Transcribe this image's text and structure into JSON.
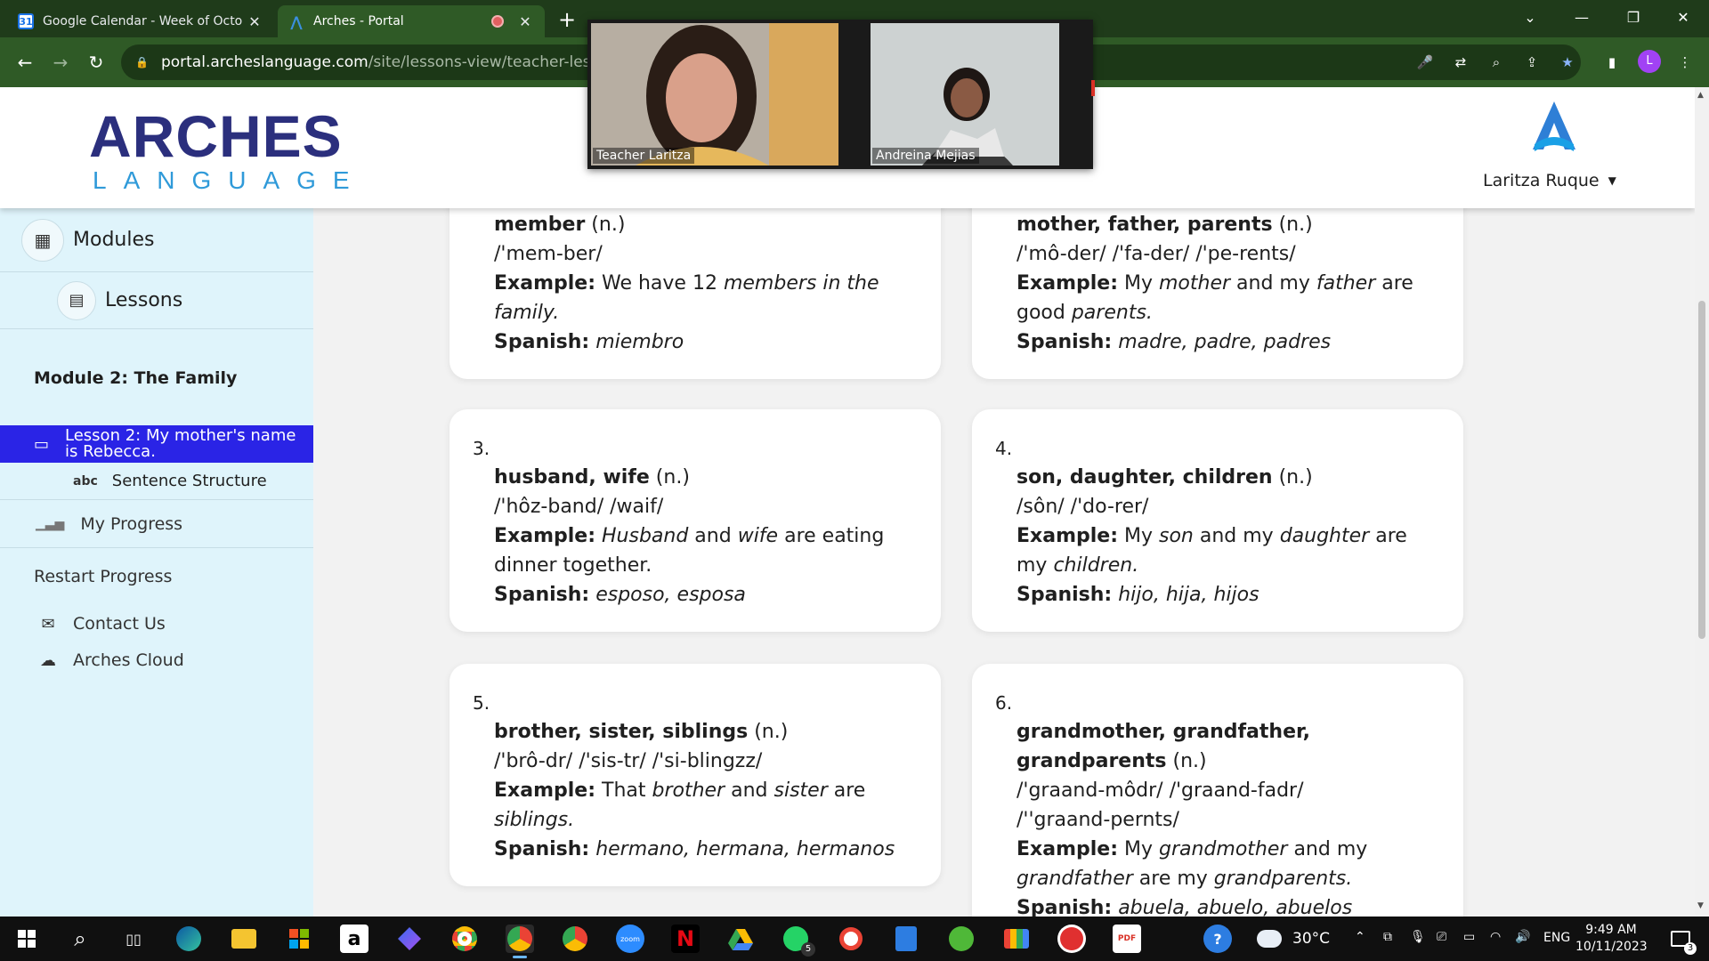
{
  "browser": {
    "tabs": [
      {
        "title": "Google Calendar - Week of Octo",
        "icon": "google-calendar-icon",
        "favicon_text": "31",
        "close": "✕"
      },
      {
        "title": "Arches - Portal",
        "icon": "arches-icon",
        "favicon_text": "⋀",
        "close": "✕"
      }
    ],
    "new_tab": "+",
    "window_controls": {
      "tab_search": "⌄",
      "minimize": "—",
      "restore": "❐",
      "close": "✕"
    },
    "nav": {
      "back": "←",
      "forward": "→",
      "reload": "↻"
    },
    "url_host": "portal.archeslanguage.com",
    "url_path": "/site/lessons-view/teacher-lesson/g",
    "profile_initial": "L",
    "toolbar_icons": {
      "mic": "🎤",
      "translate": "⇄",
      "zoom": "⌕",
      "share": "⇪",
      "bookmark": "★",
      "sidepanel": "▮",
      "menu": "⋮"
    }
  },
  "video": {
    "participants": [
      {
        "name": "Teacher Laritza"
      },
      {
        "name": "Andreina Mejias"
      }
    ]
  },
  "header": {
    "logo_top": "ARCHES",
    "logo_bottom": "LANGUAGE",
    "user_name": "Laritza Ruque",
    "caret": "▼"
  },
  "sidebar": {
    "modules_label": "Modules",
    "lessons_label": "Lessons",
    "module_title": "Module 2: The Family",
    "active_lesson": "Lesson 2: My mother's name is Rebecca.",
    "sentence_structure": "Sentence Structure",
    "sentence_icon": "abc",
    "my_progress": "My Progress",
    "restart_progress": "Restart Progress",
    "contact_us": "Contact Us",
    "arches_cloud": "Arches Cloud"
  },
  "labels": {
    "example": "Example:",
    "spanish": "Spanish:"
  },
  "cards": [
    {
      "number": "",
      "term": "member",
      "pos": "(n.)",
      "ipa": "/'mem-ber/",
      "example": [
        {
          "t": "We have 12 ",
          "i": false
        },
        {
          "t": "members in the family.",
          "i": true
        }
      ],
      "spanish": "miembro"
    },
    {
      "number": "",
      "term": "mother, father, parents",
      "pos": "(n.)",
      "ipa": "/'mô-der/ /'fa-der/ /'pe-rents/",
      "example": [
        {
          "t": "My ",
          "i": false
        },
        {
          "t": "mother",
          "i": true
        },
        {
          "t": " and my ",
          "i": false
        },
        {
          "t": "father",
          "i": true
        },
        {
          "t": " are good ",
          "i": false
        },
        {
          "t": "parents.",
          "i": true
        }
      ],
      "spanish": "madre, padre, padres"
    },
    {
      "number": "3.",
      "term": "husband, wife",
      "pos": "(n.)",
      "ipa": "/'hôz-band/ /waif/",
      "example": [
        {
          "t": "Husband",
          "i": true
        },
        {
          "t": " and ",
          "i": false
        },
        {
          "t": "wife",
          "i": true
        },
        {
          "t": " are eating dinner together.",
          "i": false
        }
      ],
      "spanish": "esposo, esposa"
    },
    {
      "number": "4.",
      "term": "son, daughter, children",
      "pos": "(n.)",
      "ipa": "/sôn/ /'do-rer/",
      "example": [
        {
          "t": "My ",
          "i": false
        },
        {
          "t": "son",
          "i": true
        },
        {
          "t": " and my ",
          "i": false
        },
        {
          "t": "daughter",
          "i": true
        },
        {
          "t": " are my ",
          "i": false
        },
        {
          "t": "children.",
          "i": true
        }
      ],
      "spanish": "hijo, hija, hijos"
    },
    {
      "number": "5.",
      "term": "brother, sister, siblings",
      "pos": "(n.)",
      "ipa": "/'brô-dr/ /'sis-tr/ /'si-blingzz/",
      "example": [
        {
          "t": "That ",
          "i": false
        },
        {
          "t": "brother",
          "i": true
        },
        {
          "t": " and ",
          "i": false
        },
        {
          "t": "sister",
          "i": true
        },
        {
          "t": " are ",
          "i": false
        },
        {
          "t": "siblings.",
          "i": true
        }
      ],
      "spanish": "hermano, hermana, hermanos"
    },
    {
      "number": "6.",
      "term": "grandmother, grandfather, grandparents",
      "pos": "(n.)",
      "ipa": "/'graand-môdr/ /'graand-fadr/ /''graand-pernts/",
      "example": [
        {
          "t": "My ",
          "i": false
        },
        {
          "t": "grandmother",
          "i": true
        },
        {
          "t": " and my ",
          "i": false
        },
        {
          "t": "grandfather",
          "i": true
        },
        {
          "t": " are my ",
          "i": false
        },
        {
          "t": "grandparents.",
          "i": true
        }
      ],
      "spanish": "abuela, abuelo, abuelos"
    }
  ],
  "taskbar": {
    "apps": [
      "windows-start-icon",
      "search-icon",
      "task-view-icon",
      "edge-icon",
      "file-explorer-icon",
      "store-icon",
      "amazon-icon",
      "copilot-icon",
      "chrome-icon",
      "chrome-profile-icon",
      "chrome-icon",
      "zoom-icon",
      "netflix-icon",
      "google-drive-icon",
      "whatsapp-icon",
      "brave-icon",
      "calculator-icon",
      "utorrent-icon",
      "meet-icon",
      "record-icon",
      "pdf-icon"
    ],
    "amazon_glyph": "a",
    "zoom_glyph": "zoom",
    "netflix_glyph": "N",
    "whatsapp_badge": "5",
    "pdf_glyph": "PDF",
    "help_glyph": "?",
    "temperature": "30°C",
    "language": "ENG",
    "time": "9:49 AM",
    "date": "10/11/2023",
    "notifications": "3"
  },
  "colors": {
    "tab_strip": "#1f3b1a",
    "toolbar": "#2f5a26",
    "sidebar_bg": "#dff4fb",
    "active_lesson_bg": "#2a24e6",
    "logo_navy": "#2b2f7d",
    "logo_blue": "#2f9ad9"
  }
}
